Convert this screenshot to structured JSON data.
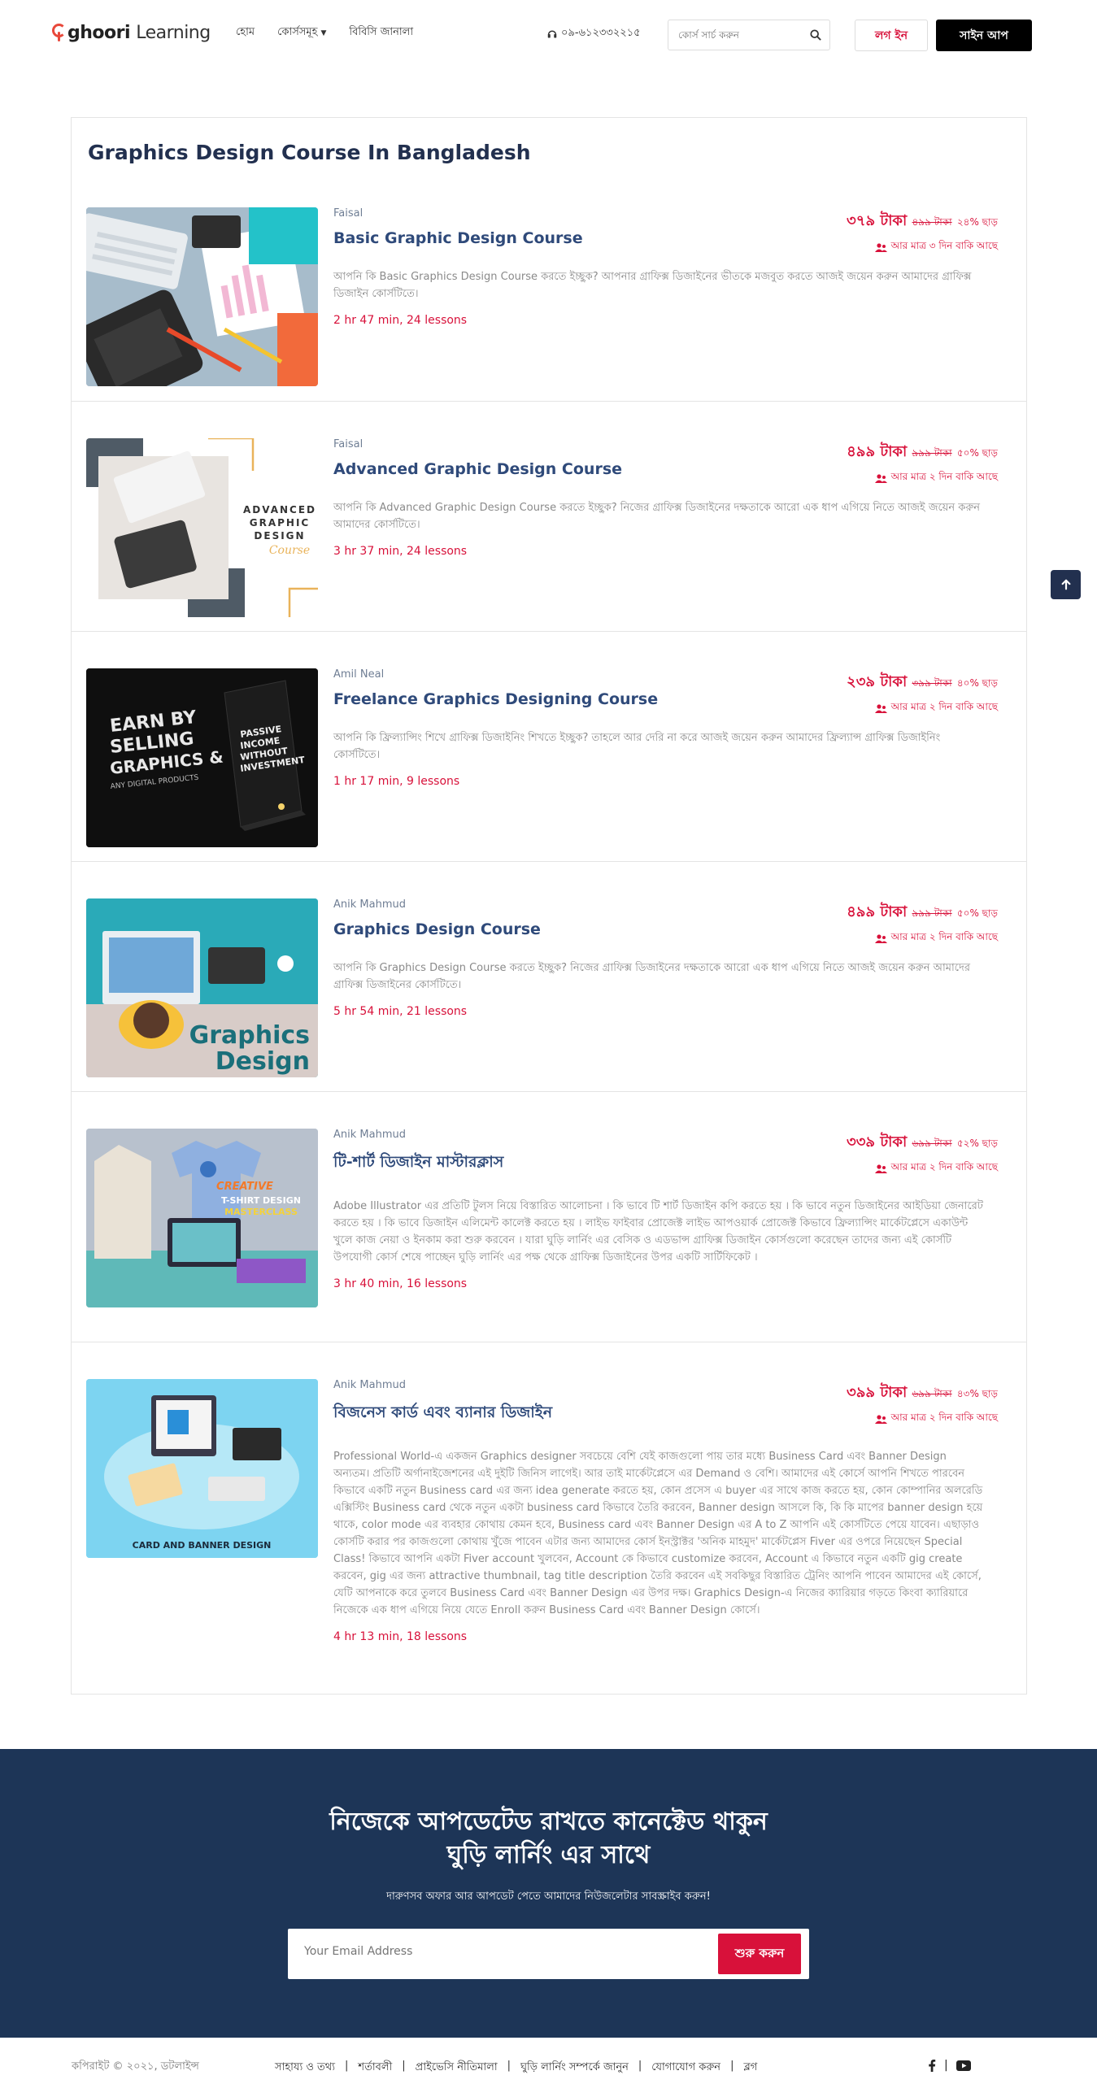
{
  "header": {
    "logo_main": "ghoori",
    "logo_light": "Learning",
    "nav": [
      {
        "label": "হোম"
      },
      {
        "label": "কোর্সসমূহ"
      },
      {
        "label": "বিবিসি জানালা"
      }
    ],
    "phone": "০৯-৬১২৩৩২২১৫",
    "search_placeholder": "কোর্স সার্চ করুন",
    "login_label": "লগ ইন",
    "signup_label": "সাইন আপ"
  },
  "page_title": "Graphics Design Course In Bangladesh",
  "courses": [
    {
      "instructor": "Faisal",
      "title": "Basic Graphic Design Course",
      "desc": "আপনি কি Basic Graphics Design Course করতে ইচ্ছুক? আপনার গ্রাফিক্স ডিজাইনের ভীতকে মজবুত করতে আজই জয়েন করুন আমাদের গ্রাফিক্স ডিজাইন কোর্সটিতে।",
      "meta": "2 hr 47 min, 24 lessons",
      "price": "৩৭৯ টাকা",
      "old_price": "৪৯৯ টাকা",
      "discount": "২৪% ছাড়",
      "days_left": "আর মাত্র ৩ দিন বাকি আছে"
    },
    {
      "instructor": "Faisal",
      "title": "Advanced Graphic Design Course",
      "desc": "আপনি কি Advanced Graphic Design Course করতে ইচ্ছুক? নিজের গ্রাফিক্স ডিজাইনের দক্ষতাকে আরো এক ধাপ এগিয়ে নিতে আজই জয়েন করুন আমাদের কোর্সটিতে।",
      "meta": "3 hr 37 min, 24 lessons",
      "price": "৪৯৯ টাকা",
      "old_price": "৯৯৯ টাকা",
      "discount": "৫০% ছাড়",
      "days_left": "আর মাত্র ২ দিন বাকি আছে"
    },
    {
      "instructor": "Amil Neal",
      "title": "Freelance Graphics Designing Course",
      "desc": "আপনি কি ফ্রিল্যান্সিং শিখে গ্রাফিক্স ডিজাইনিং শিখতে ইচ্ছুক? তাহলে আর দেরি না করে আজই জয়েন করুন আমাদের ফ্রিল্যান্স গ্রাফিক্স ডিজাইনিং কোর্সটিতে।",
      "meta": "1 hr 17 min, 9 lessons",
      "price": "২৩৯ টাকা",
      "old_price": "৩৯৯ টাকা",
      "discount": "৪০% ছাড়",
      "days_left": "আর মাত্র ২ দিন বাকি আছে"
    },
    {
      "instructor": "Anik Mahmud",
      "title": "Graphics Design Course",
      "desc": "আপনি কি Graphics Design Course করতে ইচ্ছুক? নিজের গ্রাফিক্স ডিজাইনের দক্ষতাকে আরো এক ধাপ এগিয়ে নিতে আজই জয়েন করুন আমাদের গ্রাফিক্স ডিজাইনের কোর্সটিতে।",
      "meta": "5 hr 54 min, 21 lessons",
      "price": "৪৯৯ টাকা",
      "old_price": "৯৯৯ টাকা",
      "discount": "৫০% ছাড়",
      "days_left": "আর মাত্র ২ দিন বাকি আছে"
    },
    {
      "instructor": "Anik Mahmud",
      "title": "টি-শার্ট ডিজাইন মাস্টারক্লাস",
      "desc": "Adobe Illustrator এর প্রতিটি টুলস নিয়ে বিস্তারিত আলোচনা । কি ভাবে টি শার্ট ডিজাইন কপি করতে হয় । কি ভাবে নতুন ডিজাইনের আইডিয়া জেনারেট করতে হয় । কি ভাবে ডিজাইন এলিমেন্ট কালেক্ট করতে হয় । লাইভ ফাইবার প্রোজেক্ট লাইভ আপওয়ার্ক প্রোজেক্ট কিভাবে ফ্রিল্যান্সিং মার্কেটপ্লেসে একাউন্ট খুলে কাজ নেয়া ও ইনকাম করা শুরু করবেন । যারা ঘুড়ি লার্নিং এর বেসিক ও এডভান্স গ্রাফিক্স ডিজাইন কোর্সগুলো করেছেন তাদের জন্য এই কোর্সটি উপযোগী কোর্স শেষে পাচ্ছেন ঘুড়ি লার্নিং এর পক্ষ থেকে গ্রাফিক্স ডিজাইনের উপর একটি সার্টিফিকেট ।",
      "meta": "3 hr 40 min, 16 lessons",
      "price": "৩৩৯ টাকা",
      "old_price": "৬৯৯ টাকা",
      "discount": "৫২% ছাড়",
      "days_left": "আর মাত্র ২ দিন বাকি আছে"
    },
    {
      "instructor": "Anik Mahmud",
      "title": "বিজনেস কার্ড এবং ব্যানার ডিজাইন",
      "desc": "Professional World-এ একজন Graphics designer সবচেয়ে বেশি যেই কাজগুলো পায় তার মধ্যে Business Card এবং Banner Design অন্যতম। প্রতিটি অর্গানাইজেশনের এই দুইটি জিনিস লাগেই। আর তাই মার্কেটপ্লেসে এর Demand ও বেশি। আমাদের এই কোর্সে আপনি শিখতে পারবেন কিভাবে একটি নতুন Business card এর জন্য idea generate করতে হয়, কোন প্রসেস এ buyer এর সাথে কাজ করতে হয়, কোন কোম্পানির অলরেডি এক্সিস্টিং Business card থেকে নতুন একটা business card কিভাবে তৈরি করবেন, Banner design আসলে কি, কি কি মাপের banner design হয়ে থাকে, color mode এর ব্যবহার কোথায় কেমন হবে, Business card এবং Banner Design এর A to Z আপনি এই কোর্সটিতে পেয়ে যাবেন। এছাড়াও কোর্সটি করার পর কাজগুলো কোথায় খুঁজে পাবেন এটার জন্য আমাদের কোর্স ইনস্ট্রাক্টর 'অনিক মাহমুদ' মার্কেটপ্লেস Fiver এর ওপরে নিয়েছেন Special Class! কিভাবে আপনি একটা Fiver account খুলবেন, Account কে কিভাবে customize করবেন, Account এ কিভাবে নতুন একটি gig create করবেন, gig এর জন্য attractive thumbnail, tag title description তৈরি করবেন এই সবকিছুর বিস্তারিত ট্রেনিং আপনি পাবেন আমাদের এই কোর্সে, যেটি আপনাকে করে তুলবে Business Card এবং Banner Design এর উপর দক্ষ। Graphics Design-এ নিজের ক্যারিয়ার গড়তে কিংবা ক্যারিয়ারে নিজেকে এক ধাপ এগিয়ে নিয়ে যেতে Enroll করুন Business Card এবং Banner Design কোর্সে।",
      "meta": "4 hr 13 min, 18 lessons",
      "price": "৩৯৯ টাকা",
      "old_price": "৬৯৯ টাকা",
      "discount": "৪৩% ছাড়",
      "days_left": "আর মাত্র ২ দিন বাকি আছে"
    }
  ],
  "thumbnails": {
    "t2_text": [
      "ADVANCED",
      "GRAPHIC",
      "DESIGN",
      "Course"
    ],
    "t3_text": [
      "EARN BY",
      "SELLING",
      "GRAPHICS &",
      "ANY DIGITAL PRODUCTS"
    ],
    "t3_box": [
      "PASSIVE",
      "INCOME",
      "WITHOUT",
      "INVESTMENT"
    ],
    "t4_text": [
      "Graphics",
      "Design"
    ],
    "t5_text": [
      "CREATIVE",
      "T-SHIRT DESIGN",
      "MASTERCLASS"
    ],
    "t6_text": "CARD AND BANNER DESIGN"
  },
  "newsletter": {
    "title_line1": "নিজেকে আপডেটেড রাখতে কানেক্টেড থাকুন",
    "title_line2": "ঘুড়ি লার্নিং এর সাথে",
    "subtitle": "দারুণসব অফার আর আপডেট পেতে আমাদের নিউজলেটার সাবস্ক্রাইব করুন!",
    "email_placeholder": "Your Email Address",
    "button": "শুরু করুন"
  },
  "footer": {
    "copyright": "কপিরাইট © ২০২১, ডটলাইন্স",
    "links": [
      "সাহায্য ও তথ্য",
      "শর্তাবলী",
      "প্রাইভেসি নীতিমালা",
      "ঘুড়ি লার্নিং সম্পর্কে জানুন",
      "যোগাযোগ করুন",
      "ব্লগ"
    ],
    "social_sep": "|"
  },
  "colors": {
    "accent": "#d8113a",
    "navy": "#1d3557",
    "title": "#2f4a7a"
  }
}
